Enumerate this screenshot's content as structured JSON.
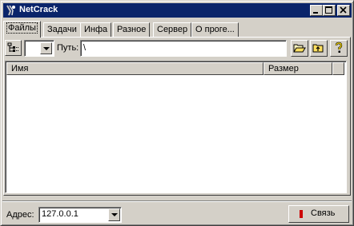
{
  "window": {
    "title": "NetCrack"
  },
  "tabs": [
    "Файлы",
    "Задачи",
    "Инфа",
    "Разное",
    "Сервер",
    "О проге..."
  ],
  "toolbar": {
    "drive_value": "",
    "path_label": "Путь:",
    "path_value": "\\"
  },
  "list": {
    "columns": [
      "Имя",
      "Размер"
    ]
  },
  "footer": {
    "address_label": "Адрес:",
    "address_value": "127.0.0.1",
    "connect_label": "Связь",
    "connect_indicator_color": "#cc0000"
  }
}
